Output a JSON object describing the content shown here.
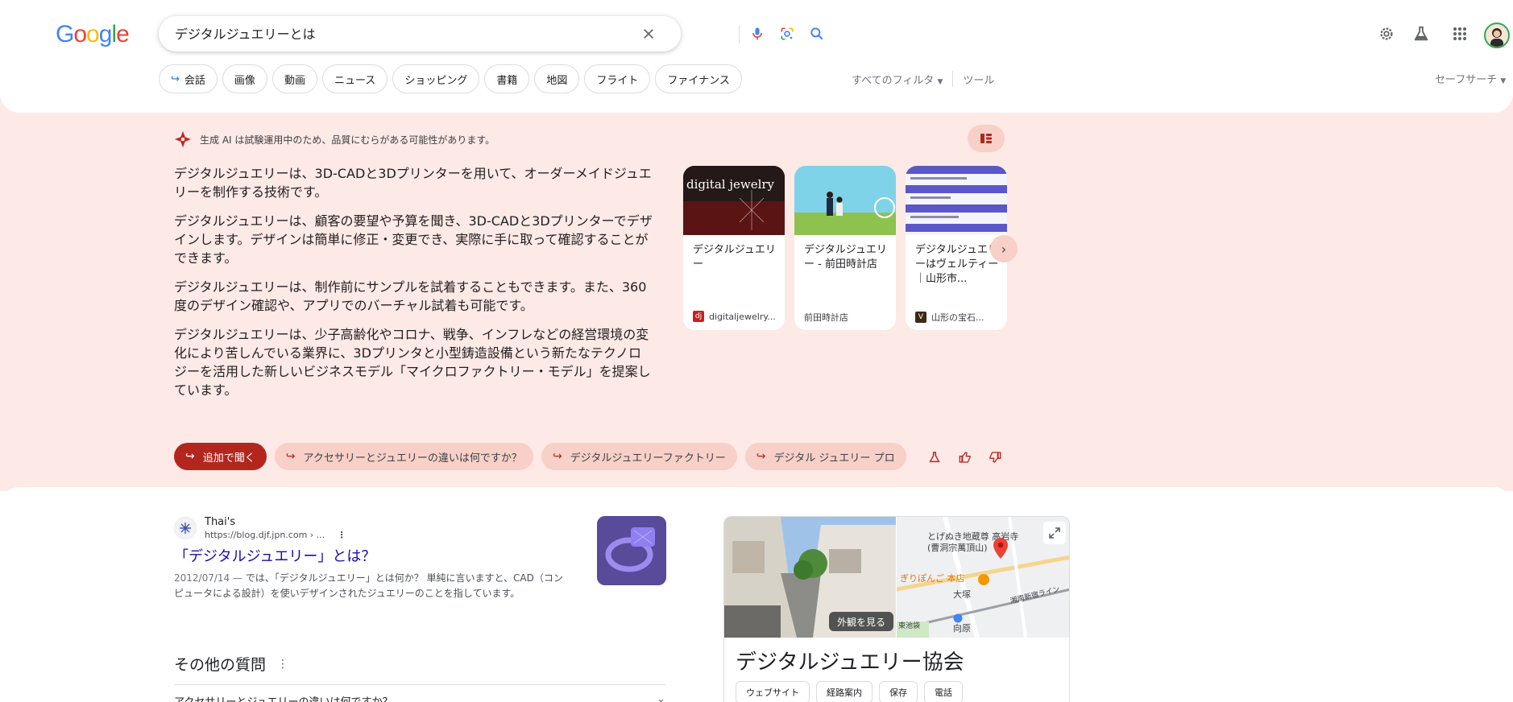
{
  "header": {
    "logo": [
      "G",
      "o",
      "o",
      "g",
      "l",
      "e"
    ],
    "logo_colors": [
      "#4285f4",
      "#ea4335",
      "#fbbc05",
      "#4285f4",
      "#34a853",
      "#ea4335"
    ],
    "search_value": "デジタルジュエリーとは"
  },
  "chips": [
    {
      "label": "会話",
      "arrow": true
    },
    {
      "label": "画像"
    },
    {
      "label": "動画"
    },
    {
      "label": "ニュース"
    },
    {
      "label": "ショッピング"
    },
    {
      "label": "書籍"
    },
    {
      "label": "地図"
    },
    {
      "label": "フライト"
    },
    {
      "label": "ファイナンス"
    }
  ],
  "filters": {
    "all_filters": "すべてのフィルタ",
    "tools": "ツール",
    "safe_search": "セーフサーチ"
  },
  "ai_overview": {
    "notice": "生成 AI は試験運用中のため、品質にむらがある可能性があります。",
    "paragraphs": [
      "デジタルジュエリーは、3D-CADと3Dプリンターを用いて、オーダーメイドジュエリーを制作する技術です。",
      "デジタルジュエリーは、顧客の要望や予算を聞き、3D-CADと3Dプリンターでデザインします。デザインは簡単に修正・変更でき、実際に手に取って確認することができます。",
      "デジタルジュエリーは、制作前にサンプルを試着することもできます。また、360度のデザイン確認や、アプリでのバーチャル試着も可能です。",
      "デジタルジュエリーは、少子高齢化やコロナ、戦争、インフレなどの経営環境の変化により苦しんでいる業界に、3Dプリンタと小型鋳造設備という新たなテクノロジーを活用した新しいビジネスモデル「マイクロファクトリー・モデル」を提案しています。"
    ],
    "cards": [
      {
        "title": "デジタルジュエリー",
        "source": "digitaljewelry...",
        "fav": "dj",
        "fav_color": "#c5221f",
        "thumb_text": "digital jewelry"
      },
      {
        "title": "デジタルジュエリー - 前田時計店",
        "source": "前田時計店",
        "fav": "",
        "fav_color": "#ffffff"
      },
      {
        "title": "デジタルジュエリーはヴェルティー｜山形市...",
        "source": "山形の宝石...",
        "fav": "V",
        "fav_color": "#3c2a14"
      }
    ],
    "followups": {
      "primary": "追加で聞く",
      "items": [
        "アクセサリーとジュエリーの違いは何ですか？",
        "デジタルジュエリーファクトリー",
        "デジタル ジュエリー プロ"
      ]
    }
  },
  "result": {
    "site_name": "Thai's",
    "url": "https://blog.djf.jpn.com › ...",
    "title": "「デジタルジュエリー」とは？",
    "date": "2012/07/14 — ",
    "snippet": "では、「デジタルジュエリー」とは何か？ 単純に言いますと、CAD（コンピュータによる設計）を使いデザインされたジュエリーのことを指しています。"
  },
  "paa": {
    "title": "その他の質問",
    "first_question": "アクセサリーとジュエリーの違いは何ですか？"
  },
  "knowledge_panel": {
    "title": "デジタルジュエリー協会",
    "view_label": "外観を見る",
    "buttons": [
      "ウェブサイト",
      "経路案内",
      "保存",
      "電話"
    ],
    "map_labels": [
      "とげぬき地蔵尊 高岩寺(曹洞宗萬頂山)",
      "ぎりぽんご 本店",
      "大塚",
      "湘南新宿ライン",
      "向原",
      "東池袋"
    ]
  },
  "colors": {
    "accent_red": "#b3261e",
    "ai_bg": "#fde9e5",
    "link": "#1a0dab"
  }
}
